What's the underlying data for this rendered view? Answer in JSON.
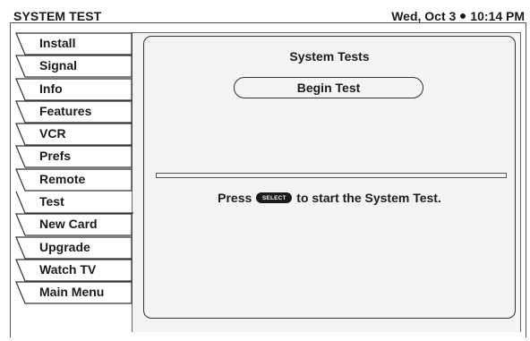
{
  "header": {
    "title": "SYSTEM TEST",
    "date": "Wed, Oct 3",
    "time": "10:14 PM"
  },
  "sidebar": {
    "items": [
      {
        "label": "Install",
        "active": false
      },
      {
        "label": "Signal",
        "active": false
      },
      {
        "label": "Info",
        "active": false
      },
      {
        "label": "Features",
        "active": false
      },
      {
        "label": "VCR",
        "active": false
      },
      {
        "label": "Prefs",
        "active": false
      },
      {
        "label": "Remote",
        "active": false
      },
      {
        "label": "Test",
        "active": true
      },
      {
        "label": "New Card",
        "active": false
      },
      {
        "label": "Upgrade",
        "active": false
      },
      {
        "label": "Watch TV",
        "active": false
      },
      {
        "label": "Main Menu",
        "active": false
      }
    ]
  },
  "panel": {
    "title": "System Tests",
    "begin_button": "Begin Test",
    "instruction_prefix": "Press",
    "select_key": "SELECT",
    "instruction_suffix": "to start the System Test."
  },
  "colors": {
    "panel_background": "#f4f4f4",
    "ink": "#1a1a1a"
  }
}
